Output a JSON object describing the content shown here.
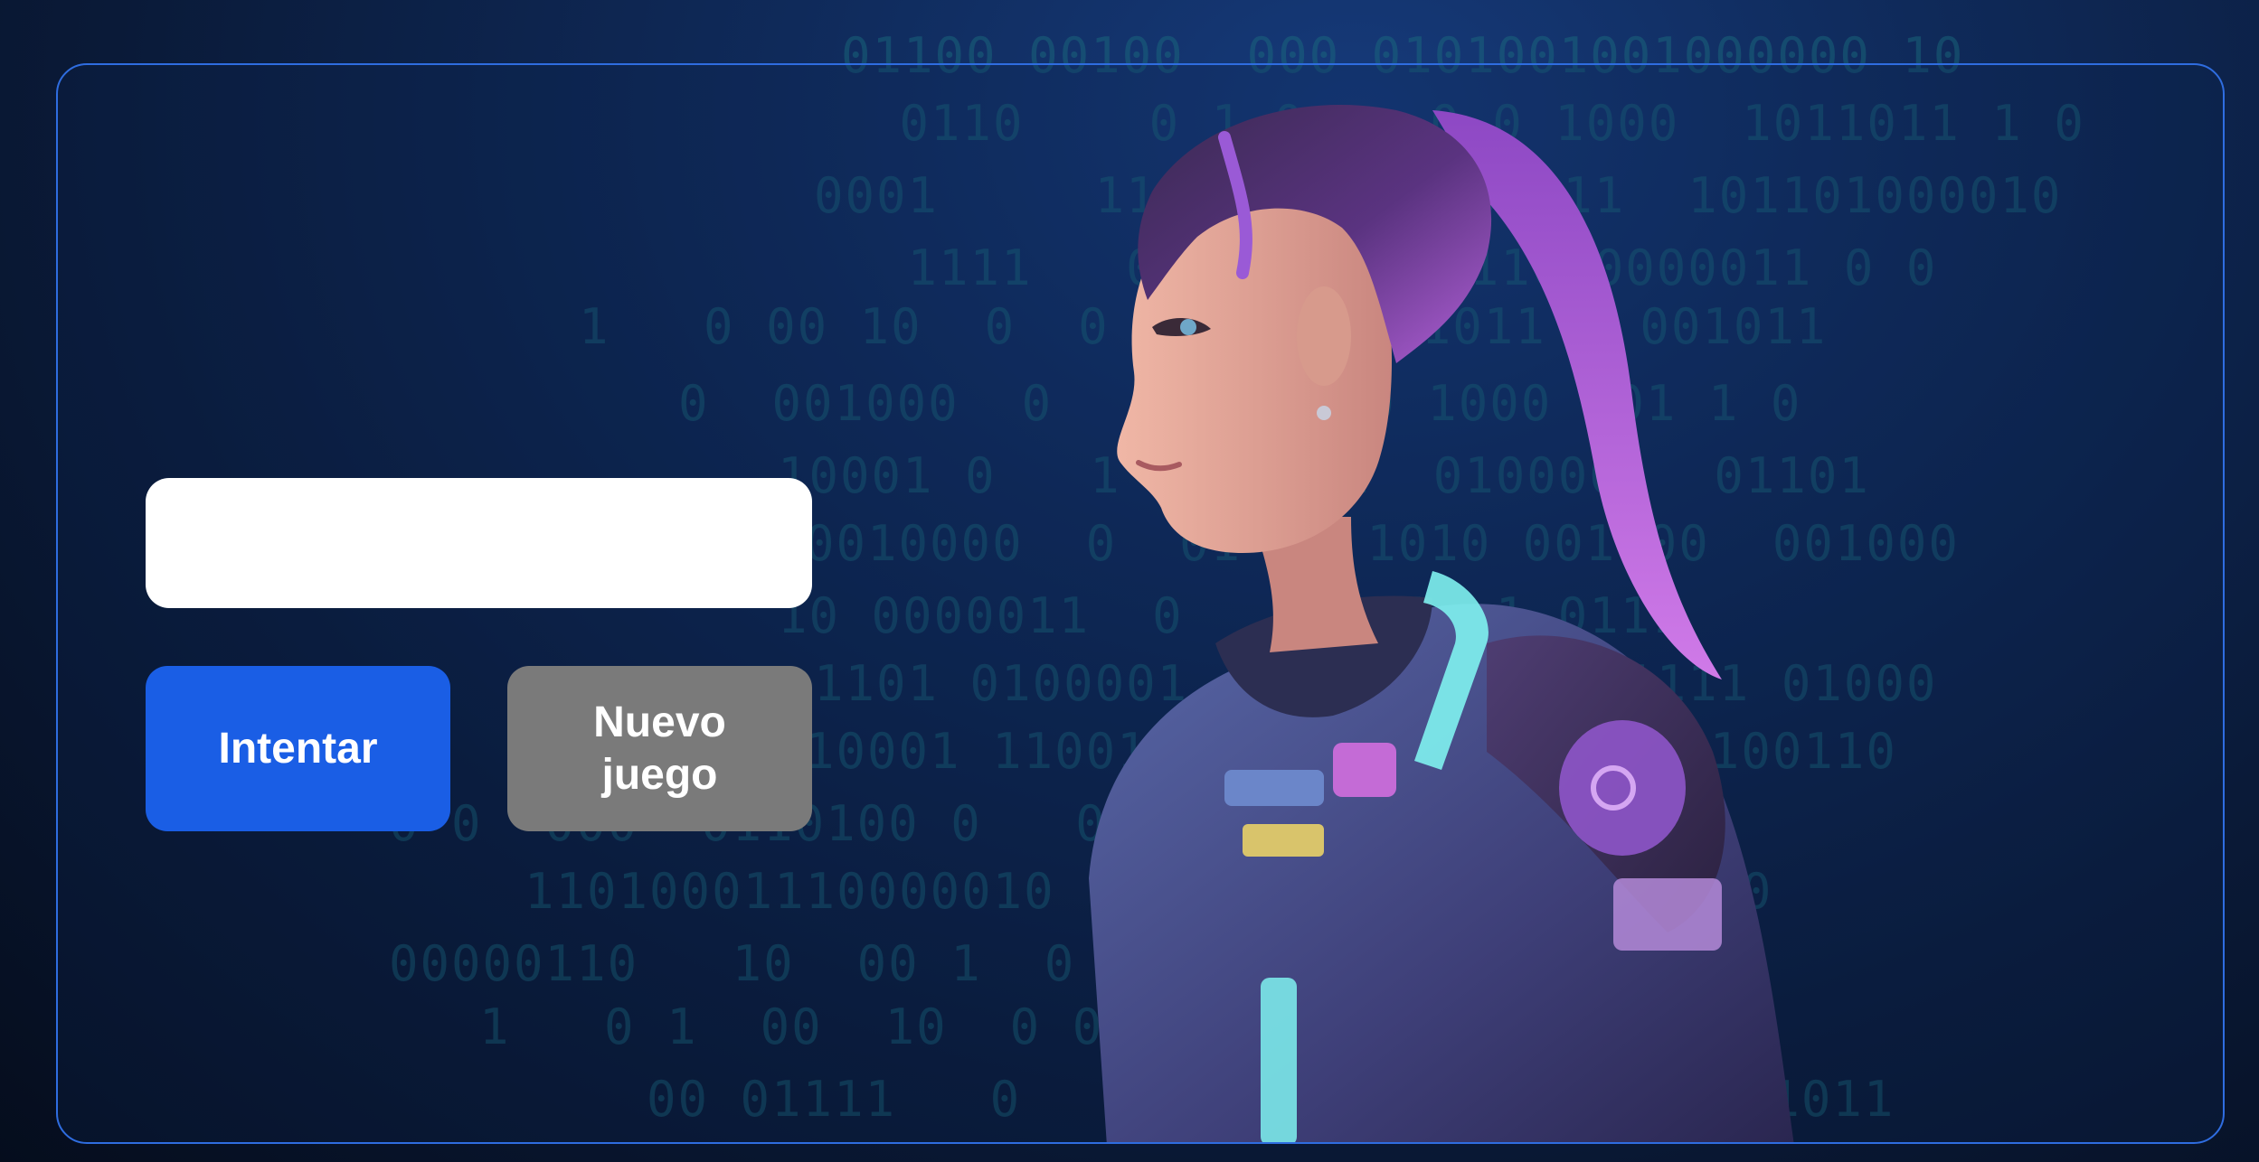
{
  "game": {
    "input": {
      "value": "",
      "placeholder": ""
    },
    "buttons": {
      "try_label": "Intentar",
      "new_game_label": "Nuevo\njuego"
    }
  },
  "background": {
    "binary_lines": [
      "01100 00100  000 0101001001000000 10",
      " 0110    0 1 0    0 0 1000  1011011 1 0",
      "0001     110  011  0101111  101101000010",
      "   1111   00   11000011000000011 0 0",
      "1   0 00 10  0  0  001  0001011 0 001011",
      "0  001000  0   011  000 1000  01 1 0",
      "10001 0   1  0  011  0100001  01101",
      "0010000  0  01  0 1010 001100  001000",
      "10 0000011  0   10 11  1 0111",
      "1101 0100001  0  01   0 111111 01000",
      "10001 11001 0  0  001 0 00110100110",
      "0 0  000  0110100 0   0  11100  1010",
      "11010001110000010  0  0001 0 00  101 1 0",
      "00000110   10  00 1  0   0 1 1101000011 0",
      "1   0 1  00  10  0 0  0  001   00   0",
      "00 01111   0   00  1  0001  0 0 01 11011"
    ],
    "colors": {
      "accent_blue": "#1a5ee5",
      "button_gray": "#7a7a7a",
      "frame_border": "#2f6de0",
      "binary_text": "#1b6f80"
    }
  },
  "character": {
    "description": "cyberpunk-character-illustration"
  }
}
